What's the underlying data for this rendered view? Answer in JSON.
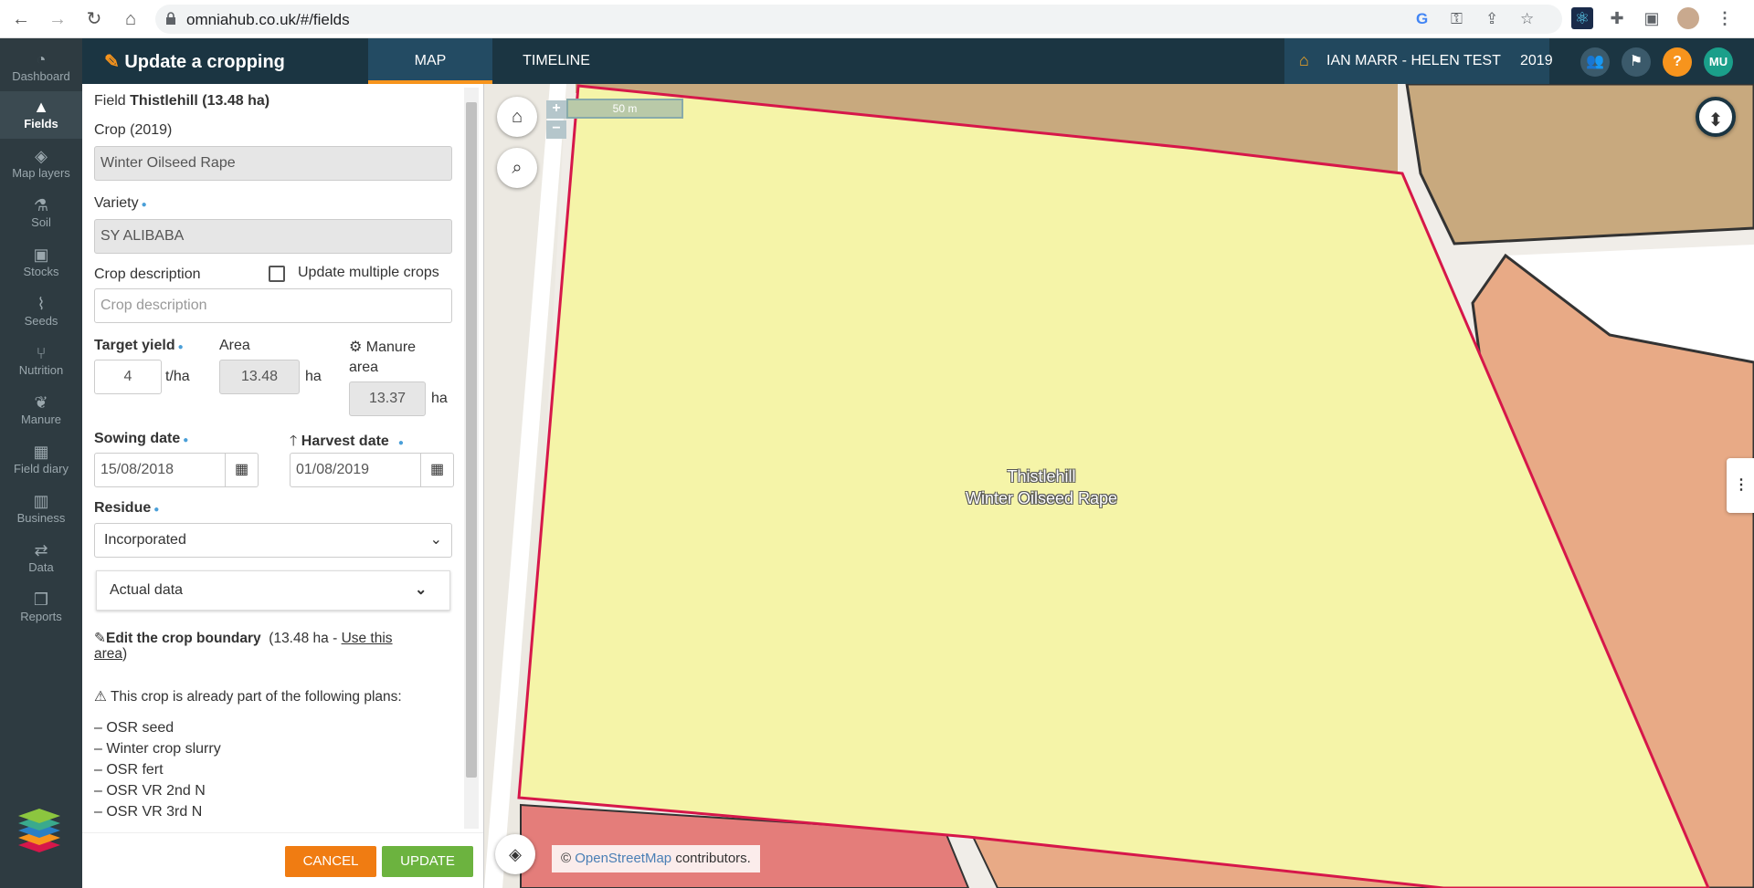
{
  "browser": {
    "url": "omniahub.co.uk/#/fields"
  },
  "sidebar": {
    "items": [
      {
        "label": "Dashboard",
        "icon": "dashboard-icon"
      },
      {
        "label": "Fields",
        "icon": "fields-icon",
        "active": true
      },
      {
        "label": "Map layers",
        "icon": "layers-icon"
      },
      {
        "label": "Soil",
        "icon": "flask-icon"
      },
      {
        "label": "Stocks",
        "icon": "box-icon"
      },
      {
        "label": "Seeds",
        "icon": "seedling-icon"
      },
      {
        "label": "Nutrition",
        "icon": "cutlery-icon"
      },
      {
        "label": "Manure",
        "icon": "plant-icon"
      },
      {
        "label": "Field diary",
        "icon": "calendar-icon"
      },
      {
        "label": "Business",
        "icon": "chart-icon"
      },
      {
        "label": "Data",
        "icon": "transfer-icon"
      },
      {
        "label": "Reports",
        "icon": "reports-icon"
      }
    ]
  },
  "header": {
    "title": "Update a cropping",
    "tabs": [
      "MAP",
      "TIMELINE"
    ],
    "farm": "IAN MARR - HELEN TEST",
    "year": "2019",
    "user_initials": "MU",
    "help": "?"
  },
  "form": {
    "field_prefix": "Field",
    "field_name": "Thistlehill (13.48 ha)",
    "crop_label": "Crop (2019)",
    "crop_value": "Winter Oilseed Rape",
    "variety_label": "Variety",
    "variety_value": "SY ALIBABA",
    "crop_desc_label": "Crop description",
    "update_multiple_label": "Update multiple crops",
    "crop_desc_placeholder": "Crop description",
    "target_yield_label": "Target yield",
    "target_yield_value": "4",
    "target_yield_unit": "t/ha",
    "area_label": "Area",
    "area_value": "13.48",
    "area_unit": "ha",
    "manure_area_label": "Manure",
    "manure_area_label2": "area",
    "manure_area_value": "13.37",
    "manure_area_unit": "ha",
    "sowing_label": "Sowing date",
    "sowing_value": "15/08/2018",
    "harvest_label": "Harvest date",
    "harvest_value": "01/08/2019",
    "residue_label": "Residue",
    "residue_value": "Incorporated",
    "actual_data_label": "Actual data",
    "edit_boundary_label": "Edit the crop boundary",
    "edit_boundary_area": "(13.48 ha -",
    "use_area_link_1": "Use this",
    "use_area_link_2": "area",
    "use_area_close": ")",
    "plans_warning": "This crop is already part of the following plans:",
    "plans": [
      "– OSR seed",
      "– Winter crop slurry",
      "– OSR fert",
      "– OSR VR 2nd N",
      "– OSR VR 3rd N"
    ],
    "cancel_label": "CANCEL",
    "update_label": "UPDATE"
  },
  "map": {
    "scale_label": "50 m",
    "field_label_1": "Thistlehill",
    "field_label_2": "Winter Oilseed Rape",
    "attribution_prefix": "©",
    "attribution_link": "OpenStreetMap",
    "attribution_suffix": "contributors."
  },
  "colors": {
    "sidebar": "#2e3b41",
    "topbar": "#1b3542",
    "accent_orange": "#f7941d",
    "cancel": "#f07c12",
    "update": "#6cb33f",
    "field_fill": "#f5f4a8",
    "field_border": "#d6174a"
  }
}
